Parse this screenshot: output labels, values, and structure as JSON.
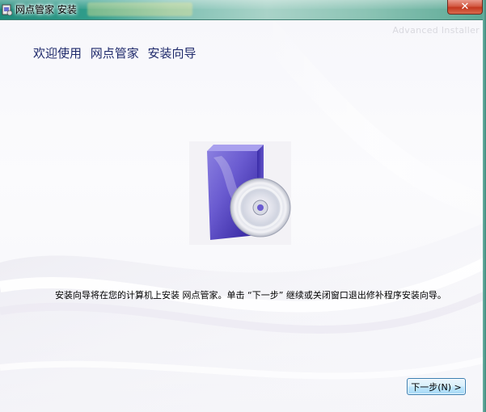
{
  "window": {
    "title": "网点管家 安装",
    "close_symbol": "✕",
    "close_icon": "close-icon",
    "app_icon": "installer-icon"
  },
  "header": {
    "title": "欢迎使用  网点管家  安装向导",
    "watermark": "Advanced Installer"
  },
  "main": {
    "image_icon": "software-box-cd-icon",
    "description": "安装向导将在您的计算机上安装 网点管家。单击 “下一步” 继续或关闭窗口退出修补程序安装向导。"
  },
  "footer": {
    "next_label": "下一步(N) >"
  },
  "colors": {
    "header_text": "#1f2a6b",
    "titlebar_accent": "#2f9c8a",
    "close_button": "#c3381f",
    "button_border": "#3c7fb1"
  }
}
